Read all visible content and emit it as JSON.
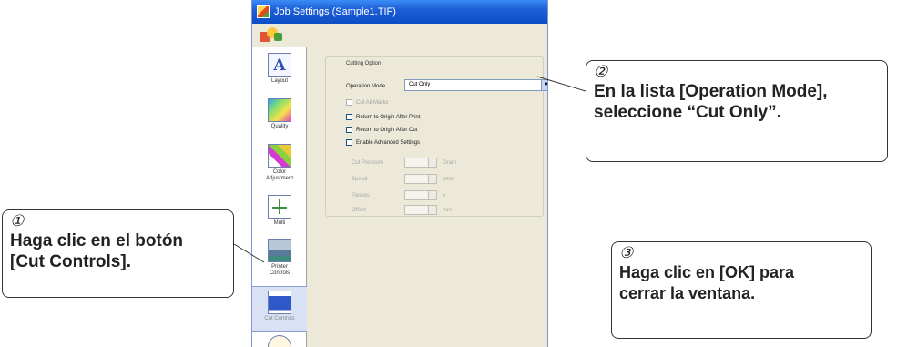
{
  "window": {
    "title": "Job Settings (Sample1.TIF)"
  },
  "sidebar": {
    "items": [
      {
        "label": "Layout",
        "icon": "layout-icon"
      },
      {
        "label": "Quality",
        "icon": "quality-icon"
      },
      {
        "label": "Color Adjustment",
        "icon": "color-adjustment-icon"
      },
      {
        "label": "Multi",
        "icon": "multi-icon"
      },
      {
        "label": "Printer Controls",
        "icon": "printer-controls-icon"
      },
      {
        "label": "Cut Controls",
        "icon": "cut-controls-icon",
        "selected": true
      }
    ]
  },
  "panel": {
    "group_title": "Cutting Option",
    "operation_mode_label": "Operation Mode",
    "operation_mode_value": "Cut Only",
    "checkboxes": [
      {
        "label": "Cut All Marks",
        "enabled": false,
        "checked": false
      },
      {
        "label": "Return to Origin After Print",
        "enabled": true,
        "checked": false
      },
      {
        "label": "Return to Origin After Cut",
        "enabled": true,
        "checked": false
      },
      {
        "label": "Enable Advanced Settings",
        "enabled": true,
        "checked": false
      }
    ],
    "advanced": [
      {
        "label": "Cut Pressure",
        "value": "",
        "unit": "Gram"
      },
      {
        "label": "Speed",
        "value": "",
        "unit": "cm/s"
      },
      {
        "label": "Passes",
        "value": "",
        "unit": "x"
      },
      {
        "label": "Offset",
        "value": "",
        "unit": "mm"
      }
    ]
  },
  "callouts": {
    "step1": {
      "number": "①",
      "line1": "Haga clic en el botón",
      "line2": "[Cut Controls]."
    },
    "step2": {
      "number": "②",
      "line1": "En la lista [Operation Mode],",
      "line2": "seleccione “Cut Only”."
    },
    "step3": {
      "number": "③",
      "line1": "Haga clic en [OK] para",
      "line2": "cerrar la ventana."
    }
  }
}
